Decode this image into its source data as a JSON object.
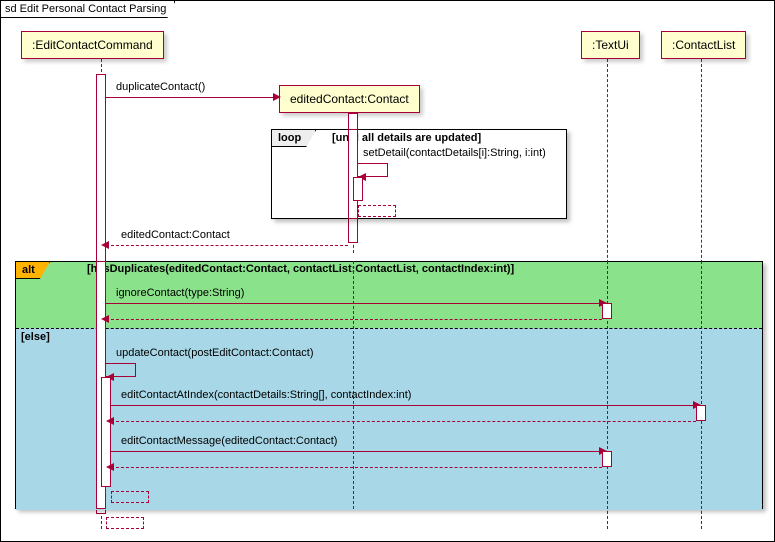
{
  "frame_title": "sd Edit Personal Contact Parsing",
  "participants": {
    "editCmd": ":EditContactCommand",
    "editedContact": "editedContact:Contact",
    "textUi": ":TextUi",
    "contactList": ":ContactList"
  },
  "messages": {
    "duplicateContact": "duplicateContact()",
    "setDetail": "setDetail(contactDetails[i]:String, i:int)",
    "returnEdited": "editedContact:Contact",
    "ignoreContact": "ignoreContact(type:String)",
    "updateContact": "updateContact(postEditContact:Contact)",
    "editContactAtIndex": "editContactAtIndex(contactDetails:String[], contactIndex:int)",
    "editContactMessage": "editContactMessage(editedContact:Contact)"
  },
  "loop": {
    "label": "loop",
    "guard": "[until all details are updated]"
  },
  "alt": {
    "label": "alt",
    "guard1": "[hasDuplicates(editedContact:Contact, contactList:ContactList, contactIndex:int)]",
    "guard2": "[else]"
  },
  "chart_data": {
    "type": "sequence-diagram",
    "frame": "sd Edit Personal Contact Parsing",
    "participants": [
      {
        "name": ":EditContactCommand",
        "created_at_start": true
      },
      {
        "name": "editedContact:Contact",
        "created_by": "duplicateContact()"
      },
      {
        "name": ":TextUi",
        "created_at_start": true
      },
      {
        "name": ":ContactList",
        "created_at_start": true
      }
    ],
    "interactions": [
      {
        "from": ":EditContactCommand",
        "to": "editedContact:Contact",
        "label": "duplicateContact()",
        "type": "sync-create"
      },
      {
        "fragment": "loop",
        "guard": "[until all details are updated]",
        "body": [
          {
            "from": "editedContact:Contact",
            "to": "editedContact:Contact",
            "label": "setDetail(contactDetails[i]:String, i:int)",
            "type": "self"
          }
        ]
      },
      {
        "from": "editedContact:Contact",
        "to": ":EditContactCommand",
        "label": "editedContact:Contact",
        "type": "return"
      },
      {
        "fragment": "alt",
        "regions": [
          {
            "guard": "[hasDuplicates(editedContact:Contact, contactList:ContactList, contactIndex:int)]",
            "body": [
              {
                "from": ":EditContactCommand",
                "to": ":TextUi",
                "label": "ignoreContact(type:String)",
                "type": "sync"
              },
              {
                "from": ":TextUi",
                "to": ":EditContactCommand",
                "type": "return"
              }
            ]
          },
          {
            "guard": "[else]",
            "body": [
              {
                "from": ":EditContactCommand",
                "to": ":EditContactCommand",
                "label": "updateContact(postEditContact:Contact)",
                "type": "self"
              },
              {
                "from": ":EditContactCommand",
                "to": ":ContactList",
                "label": "editContactAtIndex(contactDetails:String[], contactIndex:int)",
                "type": "sync"
              },
              {
                "from": ":ContactList",
                "to": ":EditContactCommand",
                "type": "return"
              },
              {
                "from": ":EditContactCommand",
                "to": ":TextUi",
                "label": "editContactMessage(editedContact:Contact)",
                "type": "sync"
              },
              {
                "from": ":TextUi",
                "to": ":EditContactCommand",
                "type": "return"
              }
            ]
          }
        ]
      }
    ]
  }
}
